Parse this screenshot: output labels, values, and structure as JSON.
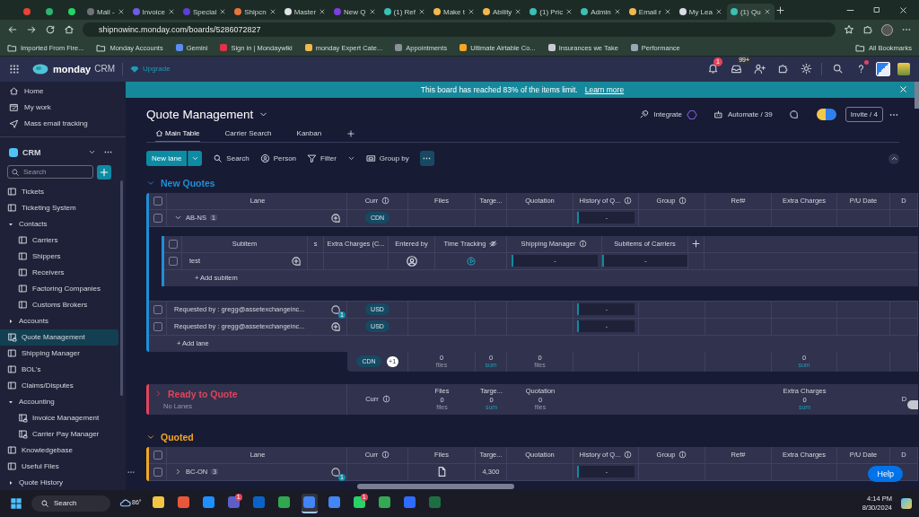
{
  "browser": {
    "tabs": [
      {
        "color": "#ea4335",
        "selected": false
      },
      {
        "color": "#2fb36f",
        "selected": false
      },
      {
        "color": "#25d366",
        "selected": false
      },
      {
        "title": "Mail -",
        "color": "#6f7378",
        "selected": false
      },
      {
        "title": "Invoice",
        "color": "#6c5ce7",
        "selected": false
      },
      {
        "title": "Special",
        "color": "#5b3fd6",
        "selected": false
      },
      {
        "title": "Shipcn",
        "color": "#e8763a",
        "selected": false
      },
      {
        "title": "Master",
        "color": "#dfe3e8",
        "selected": false
      },
      {
        "title": "New Q",
        "color": "#7b3fe4",
        "selected": false
      },
      {
        "title": "(1) Ref",
        "color": "#3dbfb3",
        "selected": false
      },
      {
        "title": "Make t",
        "color": "#f2b84c",
        "selected": false
      },
      {
        "title": "Ability",
        "color": "#f2b84c",
        "selected": false
      },
      {
        "title": "(1) Pric",
        "color": "#3dbfb3",
        "selected": false
      },
      {
        "title": "Admin",
        "color": "#3dbfb3",
        "selected": false
      },
      {
        "title": "Email r",
        "color": "#f2b84c",
        "selected": false
      },
      {
        "title": "My Lea",
        "color": "#d8dde3",
        "selected": false
      },
      {
        "title": "(1) Qu",
        "color": "#3dbfb3",
        "selected": true
      }
    ],
    "url": "shipnowinc.monday.com/boards/5286072827",
    "bookmarks": [
      {
        "label": "Imported From Fire...",
        "kind": "folder"
      },
      {
        "label": "Monday Accounts",
        "kind": "folder"
      },
      {
        "label": "Gemini",
        "kind": "site",
        "color": "#5b8def"
      },
      {
        "label": "Sign in | Mondaywiki",
        "kind": "site",
        "color": "#e0334a"
      },
      {
        "label": "monday Expert Cate...",
        "kind": "site",
        "color": "#f2b84c"
      },
      {
        "label": "Appointments",
        "kind": "site",
        "color": "#8a8f98"
      },
      {
        "label": "Ultimate Airtable Co...",
        "kind": "site",
        "color": "#f5a623"
      },
      {
        "label": "Insurances we Take",
        "kind": "site",
        "color": "#c8ccd2"
      },
      {
        "label": "Performance",
        "kind": "site",
        "color": "#9aa6b8"
      }
    ],
    "all_bookmarks": "All Bookmarks"
  },
  "app_header": {
    "brand": "monday",
    "product": "CRM",
    "upgrade": "Upgrade",
    "notifications": "1",
    "inbox": "99+"
  },
  "sidebar": {
    "nav": [
      "Home",
      "My work",
      "Mass email tracking"
    ],
    "workspace": "CRM",
    "search_placeholder": "Search",
    "items": [
      {
        "label": "Tickets",
        "kind": "board",
        "selected": false
      },
      {
        "label": "Ticketing System",
        "kind": "board",
        "selected": false
      },
      {
        "label": "Contacts",
        "kind": "folder",
        "expanded": true,
        "selected": false,
        "children": [
          {
            "label": "Carriers",
            "kind": "board",
            "selected": false
          },
          {
            "label": "Shippers",
            "kind": "board",
            "selected": false
          },
          {
            "label": "Receivers",
            "kind": "board",
            "selected": false
          },
          {
            "label": "Factoring Companies",
            "kind": "board",
            "selected": false
          },
          {
            "label": "Customs Brokers",
            "kind": "board",
            "selected": false
          }
        ]
      },
      {
        "label": "Accounts",
        "kind": "folder",
        "expanded": false,
        "selected": false
      },
      {
        "label": "Quote Management",
        "kind": "private-board",
        "selected": true
      },
      {
        "label": "Shipping Manager",
        "kind": "board",
        "selected": false
      },
      {
        "label": "BOL's",
        "kind": "board",
        "selected": false
      },
      {
        "label": "Claims/Disputes",
        "kind": "board",
        "selected": false
      },
      {
        "label": "Accounting",
        "kind": "folder",
        "expanded": true,
        "selected": false,
        "children": [
          {
            "label": "Invoice Management",
            "kind": "private-board",
            "selected": false
          },
          {
            "label": "Carrier Pay Manager",
            "kind": "private-board",
            "selected": false
          }
        ]
      },
      {
        "label": "Knowledgebase",
        "kind": "board",
        "selected": false
      },
      {
        "label": "Useful Files",
        "kind": "board",
        "selected": false
      },
      {
        "label": "Quote History",
        "kind": "folder",
        "expanded": false,
        "selected": false
      }
    ]
  },
  "banner": {
    "text": "This board has reached 83% of the items limit.",
    "link": "Learn more"
  },
  "board": {
    "title": "Quote Management",
    "views": [
      {
        "label": "Main Table",
        "selected": true
      },
      {
        "label": "Carrier Search",
        "selected": false
      },
      {
        "label": "Kanban",
        "selected": false
      }
    ],
    "integrate": "Integrate",
    "automate": "Automate / 39",
    "invite": "Invite / 4",
    "toolbar": {
      "new_item": "New lane",
      "search": "Search",
      "person": "Person",
      "filter": "Filter",
      "group_by": "Group by"
    }
  },
  "groups": [
    {
      "name": "New Quotes",
      "color": "#1f8fd6",
      "expanded": true,
      "all_checked": false,
      "columns": [
        {
          "label": "Lane"
        },
        {
          "label": "Curr",
          "info": true,
          "total": "CDN",
          "more": "+1"
        },
        {
          "label": "Files",
          "total": "0",
          "unit": "files"
        },
        {
          "label": "Targe...",
          "total": "0",
          "unit": "sum"
        },
        {
          "label": "Quotation",
          "total": "0",
          "unit": "files"
        },
        {
          "label": "History of Q...",
          "info": true
        },
        {
          "label": "Group",
          "info": true
        },
        {
          "label": "Ref#"
        },
        {
          "label": "Extra Charges",
          "total": "0",
          "unit": "sum"
        },
        {
          "label": "P/U Date"
        },
        {
          "label": "D"
        }
      ],
      "rows": [
        {
          "lane": "AB-NS",
          "subitem_count": "1",
          "expanded": true,
          "checked": false,
          "currency": "CDN",
          "history": "-",
          "subitems": {
            "all_checked": false,
            "columns": [
              {
                "label": "Subitem"
              },
              {
                "label": "s"
              },
              {
                "label": "Extra Charges (C..."
              },
              {
                "label": "Entered by"
              },
              {
                "label": "Time Tracking",
                "hidden": true
              },
              {
                "label": "Shipping Manager",
                "info": true
              },
              {
                "label": "Subitems of Carriers"
              }
            ],
            "rows": [
              {
                "name": "test",
                "checked": false,
                "shipping_manager": "-",
                "carriers": "-"
              }
            ],
            "add": "+ Add subitem"
          }
        },
        {
          "lane": "Requested by : gregg@assetexchangeinc...",
          "checked": false,
          "updates": "1",
          "currency": "USD",
          "history": "-"
        },
        {
          "lane": "Requested by : gregg@assetexchangeinc...",
          "checked": false,
          "currency": "USD",
          "history": "-"
        }
      ],
      "add": "+ Add lane"
    },
    {
      "name": "Ready to Quote",
      "color": "#e2445c",
      "expanded": false,
      "subtitle": "No Lanes",
      "columns": [
        {
          "label": "Curr",
          "info": true
        },
        {
          "label": "Files",
          "total": "0",
          "unit": "files"
        },
        {
          "label": "Targe...",
          "total": "0",
          "unit": "sum"
        },
        {
          "label": "Quotation",
          "total": "0",
          "unit": "files"
        },
        {
          "label": "Extra Charges",
          "total": "0",
          "unit": "sum"
        },
        {
          "label": "D"
        }
      ]
    },
    {
      "name": "Quoted",
      "color": "#f5a623",
      "expanded": true,
      "all_checked": false,
      "columns": [
        {
          "label": "Lane"
        },
        {
          "label": "Curr",
          "info": true
        },
        {
          "label": "Files"
        },
        {
          "label": "Targe..."
        },
        {
          "label": "Quotation"
        },
        {
          "label": "History of Q...",
          "info": true
        },
        {
          "label": "Group",
          "info": true
        },
        {
          "label": "Ref#"
        },
        {
          "label": "Extra Charges"
        },
        {
          "label": "P/U Date"
        },
        {
          "label": "D"
        }
      ],
      "rows": [
        {
          "lane": "BC-ON",
          "subitem_count": "3",
          "expanded": false,
          "checked": false,
          "updates": "1",
          "attachment": true,
          "target": "4,300",
          "history": "-"
        }
      ]
    }
  ],
  "help": "Help",
  "taskbar": {
    "search": "Search",
    "weather": "86°",
    "apps": [
      {
        "color": "#f4c542",
        "selected": false
      },
      {
        "color": "#e8563c",
        "selected": false
      },
      {
        "color": "#1e90ff",
        "selected": false
      },
      {
        "color": "#5b5fc7",
        "selected": false,
        "badge": "1"
      },
      {
        "color": "#0a64c8",
        "selected": false
      },
      {
        "color": "#2fa84f",
        "selected": false
      },
      {
        "color": "#4285f4",
        "selected": true
      },
      {
        "color": "#4285f4",
        "selected": false
      },
      {
        "color": "#25d366",
        "selected": false,
        "badge": "1"
      },
      {
        "color": "#34a853",
        "selected": false
      },
      {
        "color": "#2d6cff",
        "selected": false
      },
      {
        "color": "#1d6f42",
        "selected": false
      }
    ],
    "time": "4:14 PM",
    "date": "8/30/2024"
  }
}
